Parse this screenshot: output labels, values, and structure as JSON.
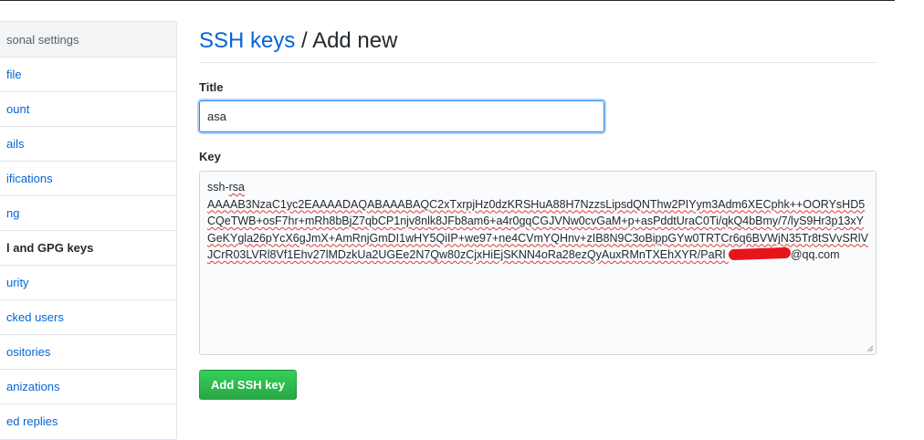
{
  "sidebar": {
    "header": "sonal settings",
    "items": [
      {
        "label": "file",
        "selected": false
      },
      {
        "label": "ount",
        "selected": false
      },
      {
        "label": "ails",
        "selected": false
      },
      {
        "label": "ifications",
        "selected": false
      },
      {
        "label": "ng",
        "selected": false
      },
      {
        "label": "l and GPG keys",
        "selected": true
      },
      {
        "label": "urity",
        "selected": false
      },
      {
        "label": "cked users",
        "selected": false
      },
      {
        "label": "ositories",
        "selected": false
      },
      {
        "label": "anizations",
        "selected": false
      },
      {
        "label": "ed replies",
        "selected": false
      }
    ]
  },
  "header": {
    "breadcrumb_link": "SSH keys",
    "separator": " / ",
    "current": "Add new"
  },
  "form": {
    "title_label": "Title",
    "title_value": "asa",
    "key_label": "Key",
    "key_line1": "ssh-rsa",
    "key_body": "AAAAB3NzaC1yc2EAAAADAQABAAABAQC2xTxrpjHz0dzKRSHuA88H7NzzsLipsdQNThw2PIYym3Adm6XECphk++OORYsHD5CQeTWB+osF7hr+mRh8bBjZ7qbCP1njv8nlk8JFb8am6+a4r0gqCGJVNw0cvGaM+p+asPddtUraC0Ti/qkQ4bBmy/7/lyS9Hr3p13xYGeKYgla26pYcX6gJmX+AmRnjGmDI1wHY5QiIP+we97+ne4CVmYQHnv+zIB8N9C3oBippGYw0TRTCr6q6BVWjN35Tr8tSVvSRlVJCrR03LVRl8Vf1Ehv27lMDzkUa2UGEe2N7Qw80zCjxHiEjSKNN4oRa28ezQyAuxRMnTXEhXYR/PaRl ",
    "key_email": "@qq.com",
    "submit_label": "Add SSH key"
  },
  "colors": {
    "link": "#0366d6",
    "button_green": "#28a745",
    "selected_accent": "#e36209",
    "redaction": "#e8141b"
  }
}
